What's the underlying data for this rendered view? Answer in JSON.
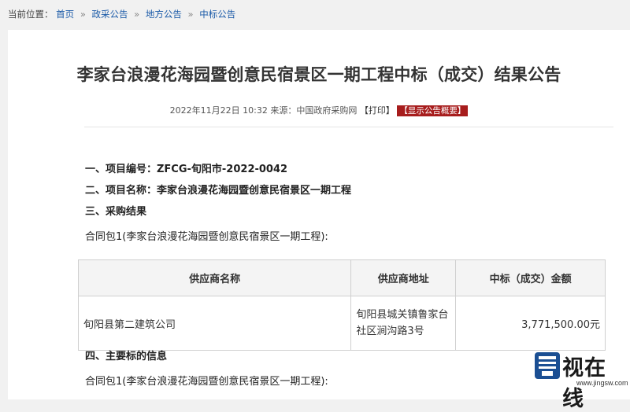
{
  "breadcrumb": {
    "prefix": "当前位置：",
    "items": [
      "首页",
      "政采公告",
      "地方公告",
      "中标公告"
    ],
    "separator": "»"
  },
  "article": {
    "title": "李家台浪漫花海园暨创意民宿景区一期工程中标（成交）结果公告",
    "meta": {
      "datetime": "2022年11月22日 10:32",
      "source": "来源：中国政府采购网",
      "print_label": "【打印】",
      "summary_label": "【显示公告概要】"
    },
    "sections": {
      "item1": "一、项目编号：ZFCG-旬阳市-2022-0042",
      "item2": "二、项目名称：李家台浪漫花海园暨创意民宿景区一期工程",
      "item3": "三、采购结果",
      "package1": "合同包1(李家台浪漫花海园暨创意民宿景区一期工程):",
      "item4": "四、主要标的信息",
      "package2": "合同包1(李家台浪漫花海园暨创意民宿景区一期工程):"
    },
    "table": {
      "headers": [
        "供应商名称",
        "供应商地址",
        "中标（成交）金额"
      ],
      "rows": [
        {
          "name": "旬阳县第二建筑公司",
          "address_line1": "旬阳县城关镇鲁家台",
          "address_line2": "社区涧沟路3号",
          "amount": "3,771,500.00元"
        }
      ]
    }
  },
  "watermark": {
    "text": "视在线",
    "url": "www.jingsw.com"
  },
  "colors": {
    "link": "#1a5aa8",
    "summary_button": "#a71d1d",
    "background": "#f1f1f1"
  }
}
